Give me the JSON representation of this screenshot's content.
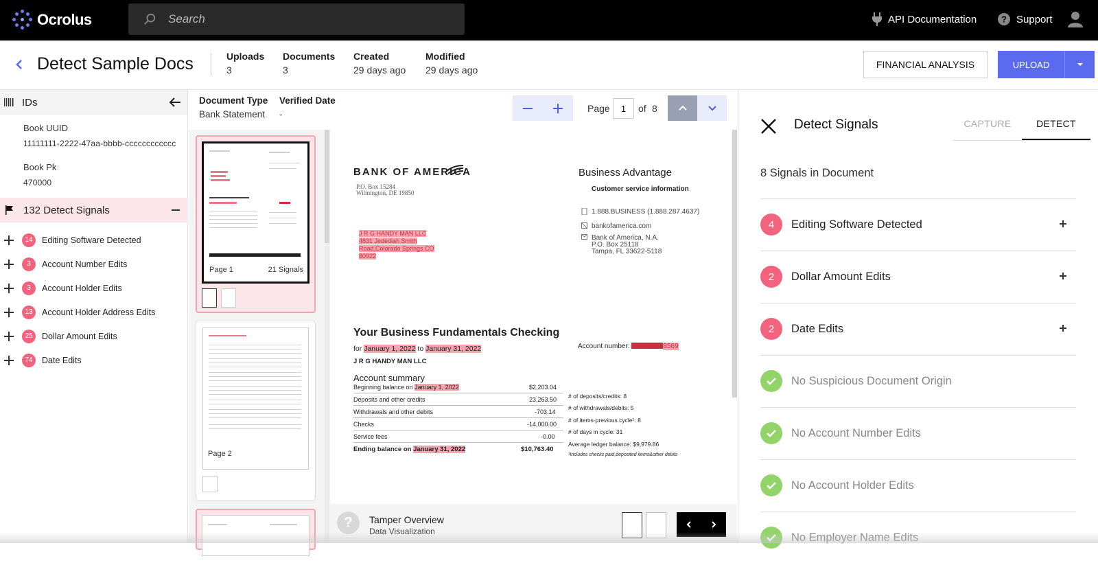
{
  "app": {
    "name": "Ocrolus"
  },
  "search": {
    "placeholder": "Search"
  },
  "top_links": {
    "api_docs": "API Documentation",
    "support": "Support"
  },
  "header": {
    "title": "Detect Sample Docs",
    "meta": [
      {
        "label": "Uploads",
        "value": "3"
      },
      {
        "label": "Documents",
        "value": "3"
      },
      {
        "label": "Created",
        "value": "29 days ago"
      },
      {
        "label": "Modified",
        "value": "29 days ago"
      }
    ],
    "financial_analysis": "FINANCIAL ANALYSIS",
    "upload": "UPLOAD"
  },
  "sidebar": {
    "ids_title": "IDs",
    "book_uuid_label": "Book UUID",
    "book_uuid_value": "11111111-2222-47aa-bbbb-cccccccccccc",
    "book_pk_label": "Book Pk",
    "book_pk_value": "470000",
    "signals_title": "132 Detect Signals",
    "signals": [
      {
        "count": "14",
        "label": "Editing Software Detected"
      },
      {
        "count": "3",
        "label": "Account Number Edits"
      },
      {
        "count": "3",
        "label": "Account Holder Edits"
      },
      {
        "count": "13",
        "label": "Account Holder Address Edits"
      },
      {
        "count": "25",
        "label": "Dollar Amount Edits"
      },
      {
        "count": "74",
        "label": "Date Edits"
      }
    ]
  },
  "docbar": {
    "doc_type_label": "Document Type",
    "doc_type_value": "Bank Statement",
    "verified_label": "Verified Date",
    "verified_value": "-",
    "page_label": "Page",
    "page_current": "1",
    "page_of": "of",
    "page_total": "8"
  },
  "thumbnails": {
    "page1_label": "Page 1",
    "page1_signals": "21 Signals",
    "page2_label": "Page 2"
  },
  "statement": {
    "bank_name": "BANK OF AMERICA",
    "bank_address_1": "P.O. Box 15284",
    "bank_address_2": "Wilmington, DE 19850",
    "product": "Business Advantage",
    "cs_heading": "Customer service information",
    "phone": "1.888.BUSINESS (1.888.287.4637)",
    "website": "bankofamerica.com",
    "cs_addr_1": "Bank of America, N.A.",
    "cs_addr_2": "P.O. Box 25118",
    "cs_addr_3": "Tampa, FL 33622-5118",
    "holder_1": "J R G HANDY MAN LLC",
    "holder_2": "4831 Jedediah Smith",
    "holder_3": "Road,Colorado Springs CO",
    "holder_4": "80922",
    "checking_title": "Your Business Fundamentals Checking",
    "for_word": "for",
    "date_from": "January 1, 2022",
    "to_word": "to",
    "date_to": "January 31, 2022",
    "account_holder": "J R G HANDY MAN  LLC",
    "account_number_label": "Account number:",
    "account_number_suffix": "8569",
    "summary_title": "Account summary",
    "rows": [
      {
        "label": "Beginning balance on",
        "date": "January 1, 2022",
        "value": "$2,203.04"
      },
      {
        "label": "Deposits and other credits",
        "value": "23,263.50"
      },
      {
        "label": "Withdrawals and other debits",
        "value": "-703.14"
      },
      {
        "label": "Checks",
        "value": "-14,000.00"
      },
      {
        "label": "Service fees",
        "value": "-0.00"
      },
      {
        "label": "Ending balance on",
        "date": "January 31, 2022",
        "value": "$10,763.40"
      }
    ],
    "stats": [
      "# of deposits/credits: 8",
      "# of withdrawals/debits: 5",
      "# of items-previous cycle¹: 8",
      "# of days in cycle: 31",
      "Average ledger balance: $9,979.86",
      "¹Includes checks paid,deposited items&other debits"
    ]
  },
  "footer": {
    "title": "Tamper Overview",
    "subtitle": "Data Visualization",
    "help": "?"
  },
  "right_panel": {
    "title": "Detect Signals",
    "tabs": [
      "CAPTURE",
      "DETECT"
    ],
    "signal_count": "8 Signals in Document",
    "signals": [
      {
        "count": "4",
        "label": "Editing Software Detected"
      },
      {
        "count": "2",
        "label": "Dollar Amount Edits"
      },
      {
        "count": "2",
        "label": "Date Edits"
      }
    ],
    "passed": [
      "No Suspicious Document Origin",
      "No Account Number Edits",
      "No Account Holder Edits",
      "No Employer Name Edits"
    ]
  },
  "colors": {
    "accent": "#5b6bf0",
    "alert": "#f2647e",
    "ok": "#93d46a",
    "highlight": "#fde6ea"
  }
}
